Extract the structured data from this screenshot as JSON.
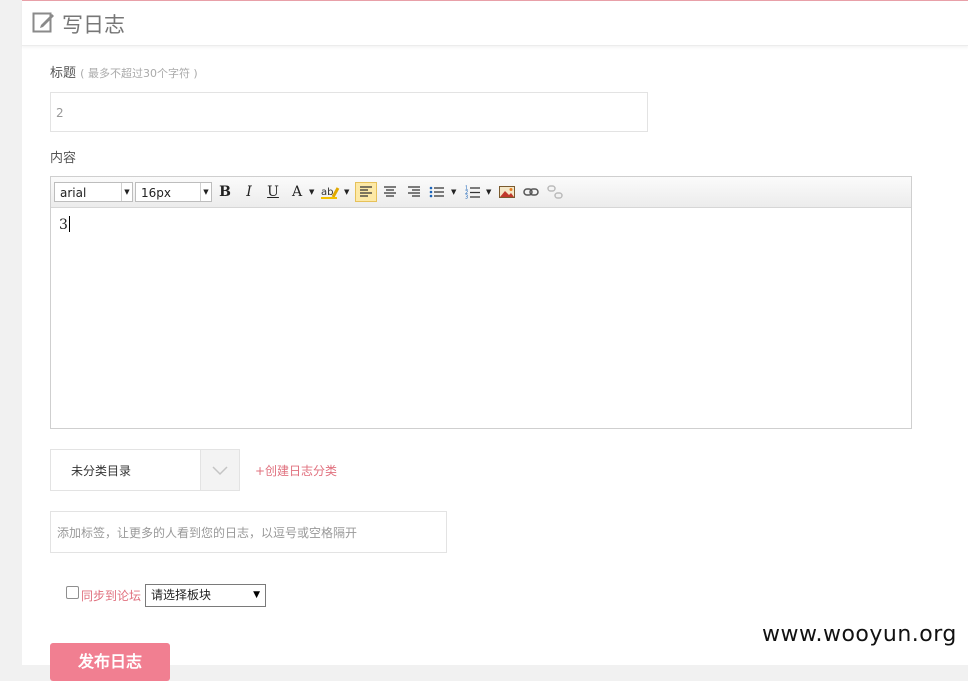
{
  "header": {
    "title": "写日志"
  },
  "title_field": {
    "label": "标题",
    "hint": "( 最多不超过30个字符 )",
    "value": "2"
  },
  "content_field": {
    "label": "内容"
  },
  "toolbar": {
    "font_family": "arial",
    "font_size": "16px",
    "bold": "B",
    "italic": "I",
    "underline": "U",
    "font_color": "A"
  },
  "editor": {
    "text": "3"
  },
  "category": {
    "selected": "未分类目录",
    "create_link": "+创建日志分类"
  },
  "tags": {
    "placeholder": "添加标签，让更多的人看到您的日志，以逗号或空格隔开"
  },
  "sync": {
    "label": "同步到论坛",
    "forum_selected": "请选择板块"
  },
  "publish_button": "发布日志",
  "watermark": "www.wooyun.org"
}
